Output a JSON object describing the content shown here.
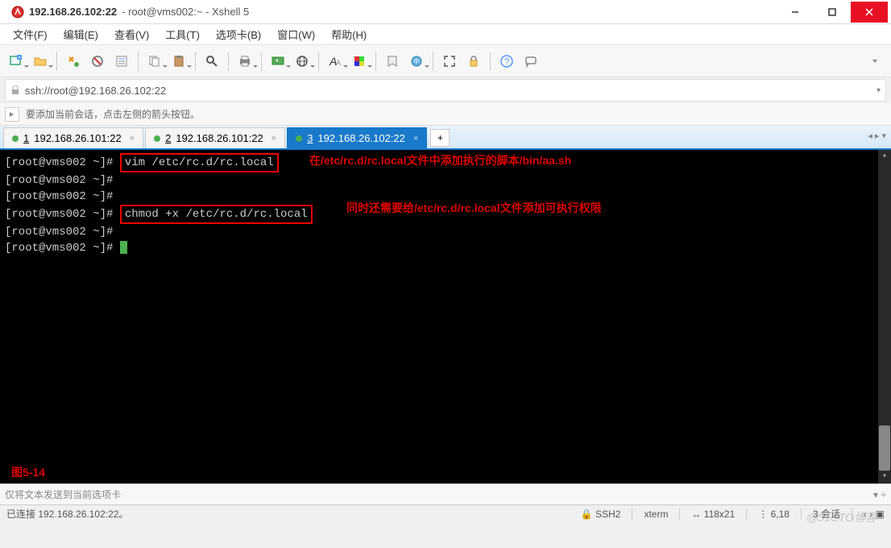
{
  "window": {
    "title_host": "192.168.26.102:22",
    "title_sub": "root@vms002:~ - Xshell 5"
  },
  "menu": {
    "file": "文件(F)",
    "edit": "编辑(E)",
    "view": "查看(V)",
    "tools": "工具(T)",
    "tabs": "选项卡(B)",
    "window": "窗口(W)",
    "help": "帮助(H)"
  },
  "address": {
    "url": "ssh://root@192.168.26.102:22"
  },
  "hint": {
    "text": "要添加当前会话，点击左侧的箭头按钮。"
  },
  "tabs": [
    {
      "num": "1",
      "label": "192.168.26.101:22",
      "active": false
    },
    {
      "num": "2",
      "label": "192.168.26.101:22",
      "active": false
    },
    {
      "num": "3",
      "label": "192.168.26.102:22",
      "active": true
    }
  ],
  "tab_add": "+",
  "terminal": {
    "prompt": "[root@vms002 ~]#",
    "cmd1": "vim /etc/rc.d/rc.local",
    "ann1": "在/etc/rc.d/rc.local文件中添加执行的脚本/bin/aa.sh",
    "cmd2": "chmod +x /etc/rc.d/rc.local",
    "ann2": "同时还需要给/etc/rc.d/rc.local文件添加可执行权限",
    "fig": "图5-14"
  },
  "sendbar": {
    "text": "仅将文本发送到当前选项卡"
  },
  "status": {
    "conn": "已连接 192.168.26.102:22。",
    "proto_icon": "🔒",
    "proto": "SSH2",
    "term": "xterm",
    "size_icon": "↔",
    "size": "118x21",
    "pos_icon": "⋮",
    "pos": "6,18",
    "sess": "3 会话",
    "nav": "‹ › ▣"
  },
  "watermark": "@51CTO博客"
}
